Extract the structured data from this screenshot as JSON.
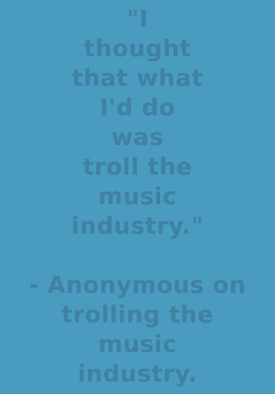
{
  "quote": {
    "lines": [
      "\"I",
      "thought",
      "that what",
      "I'd do",
      "was",
      "troll the",
      "music",
      "industry.\""
    ]
  },
  "attribution": {
    "lines": [
      "- Anonymous on",
      "trolling the",
      "music",
      "industry."
    ]
  },
  "colors": {
    "background": "#4a9bc0",
    "text": "#3f82a2"
  }
}
